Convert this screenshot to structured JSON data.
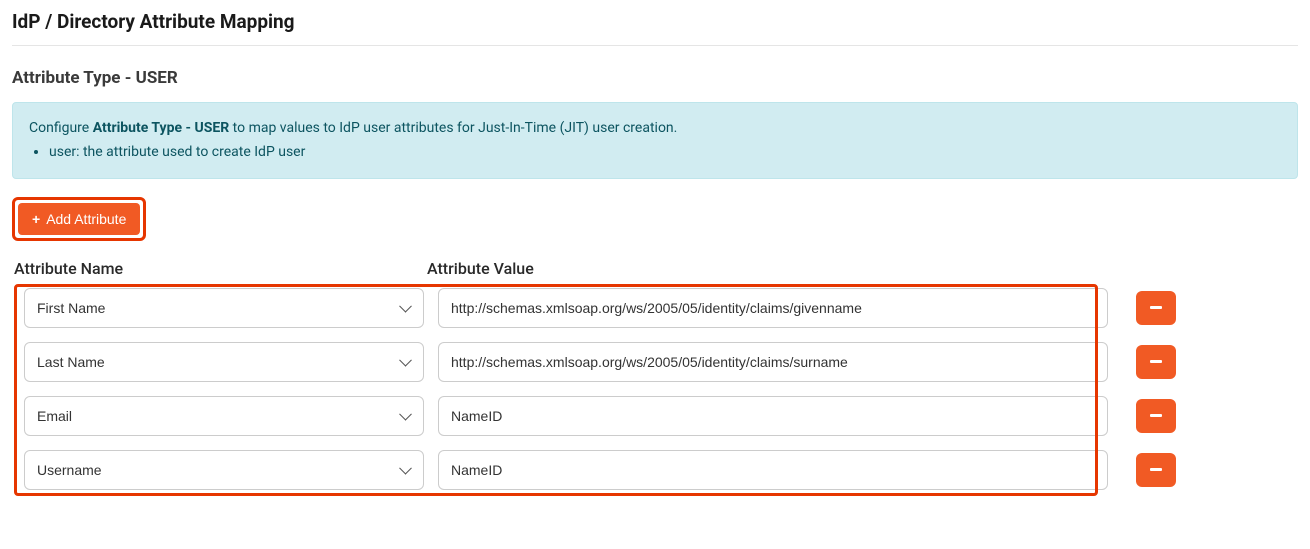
{
  "header": {
    "title": "IdP / Directory Attribute Mapping"
  },
  "section": {
    "title": "Attribute Type - USER",
    "info": {
      "prefix": "Configure ",
      "bold": "Attribute Type - USER",
      "suffix": " to map values to IdP user attributes for Just-In-Time (JIT) user creation.",
      "bullet": "user: the attribute used to create IdP user"
    }
  },
  "buttons": {
    "add_attribute": "Add Attribute"
  },
  "columns": {
    "name": "Attribute Name",
    "value": "Attribute Value"
  },
  "attribute_options": [
    "First Name",
    "Last Name",
    "Email",
    "Username"
  ],
  "rows": [
    {
      "name": "First Name",
      "value": "http://schemas.xmlsoap.org/ws/2005/05/identity/claims/givenname"
    },
    {
      "name": "Last Name",
      "value": "http://schemas.xmlsoap.org/ws/2005/05/identity/claims/surname"
    },
    {
      "name": "Email",
      "value": "NameID"
    },
    {
      "name": "Username",
      "value": "NameID"
    }
  ]
}
